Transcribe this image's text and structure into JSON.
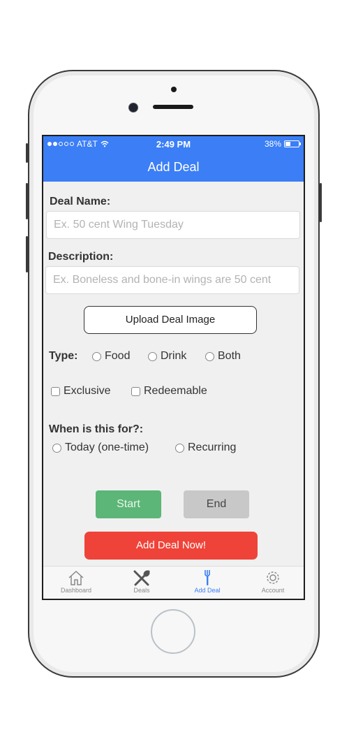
{
  "status_bar": {
    "carrier": "AT&T",
    "time": "2:49 PM",
    "battery": "38%",
    "battery_level": 0.38
  },
  "nav": {
    "title": "Add Deal"
  },
  "form": {
    "deal_name_label": "Deal Name:",
    "deal_name_placeholder": "Ex. 50 cent Wing Tuesday",
    "description_label": "Description:",
    "description_placeholder": "Ex. Boneless and bone-in wings are 50 cent",
    "upload_button": "Upload Deal Image",
    "type_label": "Type:",
    "type_options": [
      "Food",
      "Drink",
      "Both"
    ],
    "flags": [
      "Exclusive",
      "Redeemable"
    ],
    "when_label": "When is this for?:",
    "when_options": [
      "Today (one-time)",
      "Recurring"
    ],
    "start_button": "Start",
    "end_button": "End",
    "submit_button": "Add Deal Now!"
  },
  "tabs": [
    {
      "label": "Dashboard",
      "icon": "home-icon"
    },
    {
      "label": "Deals",
      "icon": "utensils-icon"
    },
    {
      "label": "Add Deal",
      "icon": "fork-icon",
      "active": true
    },
    {
      "label": "Account",
      "icon": "gear-icon"
    }
  ],
  "colors": {
    "nav_blue": "#3b7ef6",
    "start_green": "#5cb677",
    "end_gray": "#c8c8c8",
    "submit_red": "#ef4339"
  }
}
